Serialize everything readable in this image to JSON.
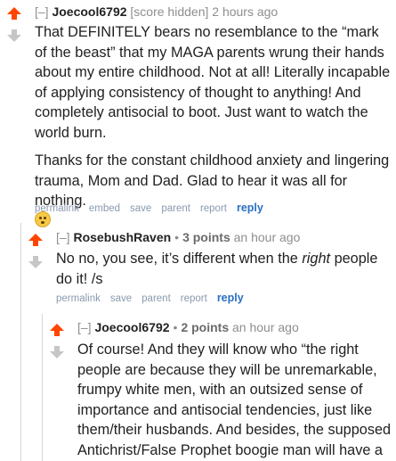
{
  "c1": {
    "toggle": "[–]",
    "author": "Joecool6792",
    "score": "[score hidden]",
    "time": "2 hours ago",
    "p1": "That DEFINITELY bears no resemblance to the “mark of the beast” that my MAGA parents wrung their hands about my entire childhood. Not at all! Literally incapable of applying consistency of thought to anything! And completely antisocial to boot. Just want to watch the world burn.",
    "p2": "Thanks for the constant childhood anxiety and lingering trauma, Mom and Dad. Glad to hear it was all for nothing.",
    "emoji": "flushed-face",
    "buttons": {
      "permalink": "permalink",
      "embed": "embed",
      "save": "save",
      "parent": "parent",
      "report": "report",
      "reply": "reply"
    }
  },
  "c2": {
    "toggle": "[–]",
    "author": "RosebushRaven",
    "dot": "•",
    "score": "3 points",
    "time": "an hour ago",
    "text_before": "No no, you see, it’s different when the ",
    "text_em": "right",
    "text_after": " people do it! /s",
    "buttons": {
      "permalink": "permalink",
      "save": "save",
      "parent": "parent",
      "report": "report",
      "reply": "reply"
    }
  },
  "c3": {
    "toggle": "[–]",
    "author": "Joecool6792",
    "dot": "•",
    "score": "2 points",
    "time": "an hour ago",
    "text": "Of course! And they will know who “the right people are because they will be unremarkable, frumpy white men, with an outsized sense of importance and antisocial tendencies, just like them/their husbands. And besides, the supposed Antichrist/False Prophet boogie man will have a giant, flashing neon sign that says"
  },
  "colors": {
    "upvote": "#ff4500",
    "downvote": "#c6c6c6",
    "reply": "#2b6fc4",
    "author": "#222222"
  }
}
